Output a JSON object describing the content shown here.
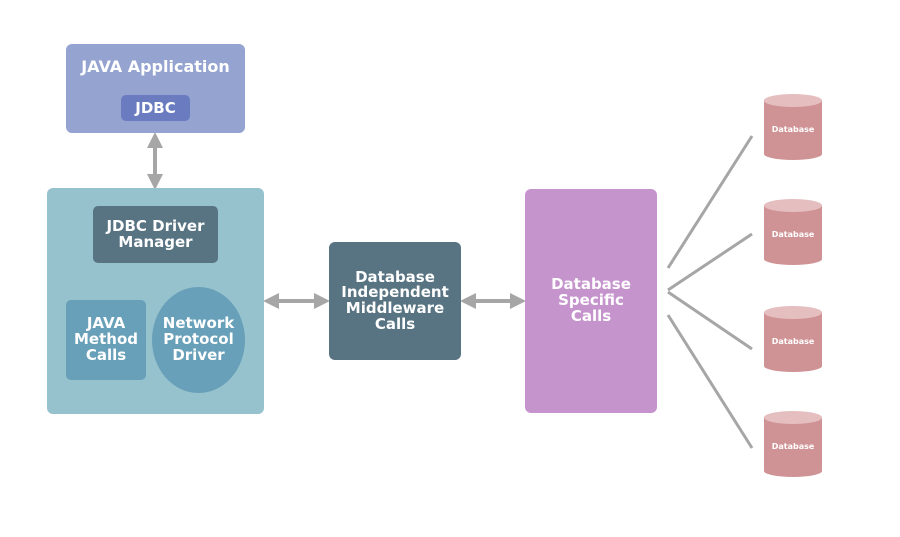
{
  "diagram": {
    "java_application": {
      "title": "JAVA Application",
      "badge": "JDBC"
    },
    "driver_container": {
      "driver_manager": "JDBC Driver\nManager",
      "java_method_calls": "JAVA\nMethod\nCalls",
      "network_protocol_driver": "Network\nProtocol\nDriver"
    },
    "middleware": "Database\nIndependent\nMiddleware\nCalls",
    "database_specific": "Database\nSpecific\nCalls",
    "databases": [
      {
        "label": "Database"
      },
      {
        "label": "Database"
      },
      {
        "label": "Database"
      },
      {
        "label": "Database"
      }
    ],
    "colors": {
      "java_app": "#94a3cf",
      "jdbc_badge": "#6a7cbf",
      "driver_container": "#96c2ce",
      "dark_slate": "#587382",
      "inner_blue": "#67a0b8",
      "db_specific": "#c594cd",
      "database": "#d09395",
      "arrow": "#a6a6a6"
    }
  }
}
